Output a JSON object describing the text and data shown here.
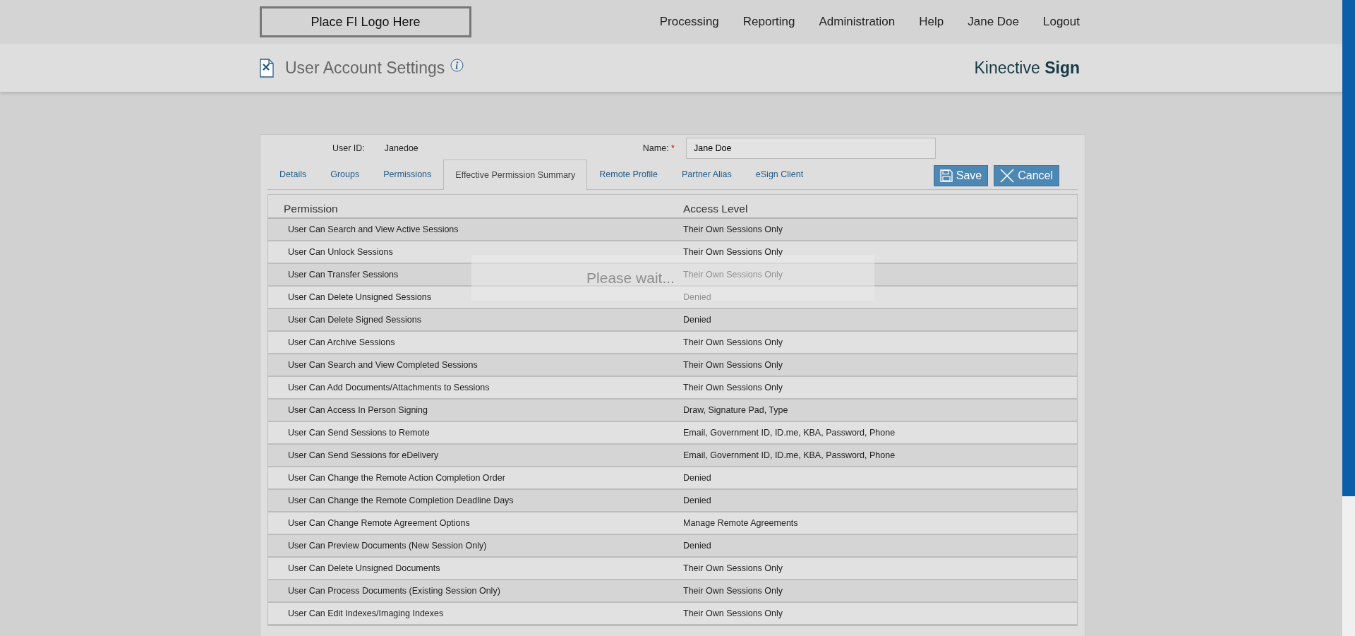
{
  "header": {
    "logo": "Place FI Logo Here",
    "nav": [
      "Processing",
      "Reporting",
      "Administration",
      "Help",
      "Jane Doe",
      "Logout"
    ]
  },
  "page_title": {
    "title": "User Account Settings",
    "brand": "Kinective",
    "brand_bold": "Sign"
  },
  "user_form": {
    "user_id_label": "User ID:",
    "user_id": "Janedoe",
    "name_label": "Name:",
    "required_mark": "*",
    "name_value": "Jane Doe"
  },
  "tabs": [
    {
      "label": "Details",
      "selected": false
    },
    {
      "label": "Groups",
      "selected": false
    },
    {
      "label": "Permissions",
      "selected": false
    },
    {
      "label": "Effective Permission Summary",
      "selected": true
    },
    {
      "label": "Remote Profile",
      "selected": false
    },
    {
      "label": "Partner Alias",
      "selected": false
    },
    {
      "label": "eSign Client",
      "selected": false
    }
  ],
  "buttons": [
    {
      "label": "Save",
      "kind": "save"
    },
    {
      "label": "Cancel",
      "kind": "cancel"
    }
  ],
  "table": {
    "columns": [
      "Permission",
      "Access Level"
    ],
    "rows": [
      [
        "User Can Search and View Active Sessions",
        "Their Own Sessions Only"
      ],
      [
        "User Can Unlock Sessions",
        "Their Own Sessions Only"
      ],
      [
        "User Can Transfer Sessions",
        "Their Own Sessions Only"
      ],
      [
        "User Can Delete Unsigned Sessions",
        "Denied"
      ],
      [
        "User Can Delete Signed Sessions",
        "Denied"
      ],
      [
        "User Can Archive Sessions",
        "Their Own Sessions Only"
      ],
      [
        "User Can Search and View Completed Sessions",
        "Their Own Sessions Only"
      ],
      [
        "User Can Add Documents/Attachments to Sessions",
        "Their Own Sessions Only"
      ],
      [
        "User Can Access In Person Signing",
        "Draw, Signature Pad, Type"
      ],
      [
        "User Can Send Sessions to Remote",
        "Email, Government ID, ID.me, KBA, Password, Phone"
      ],
      [
        "User Can Send Sessions for eDelivery",
        "Email, Government ID, ID.me, KBA, Password, Phone"
      ],
      [
        "User Can Change the Remote Action Completion Order",
        "Denied"
      ],
      [
        "User Can Change the Remote Completion Deadline Days",
        "Denied"
      ],
      [
        "User Can Change Remote Agreement Options",
        "Manage Remote Agreements"
      ],
      [
        "User Can Preview Documents (New Session Only)",
        "Denied"
      ],
      [
        "User Can Delete Unsigned Documents",
        "Their Own Sessions Only"
      ],
      [
        "User Can Process Documents (Existing Session Only)",
        "Their Own Sessions Only"
      ],
      [
        "User Can Edit Indexes/Imaging Indexes",
        "Their Own Sessions Only"
      ]
    ]
  },
  "loading_overlay": {
    "text": "Please wait..."
  }
}
